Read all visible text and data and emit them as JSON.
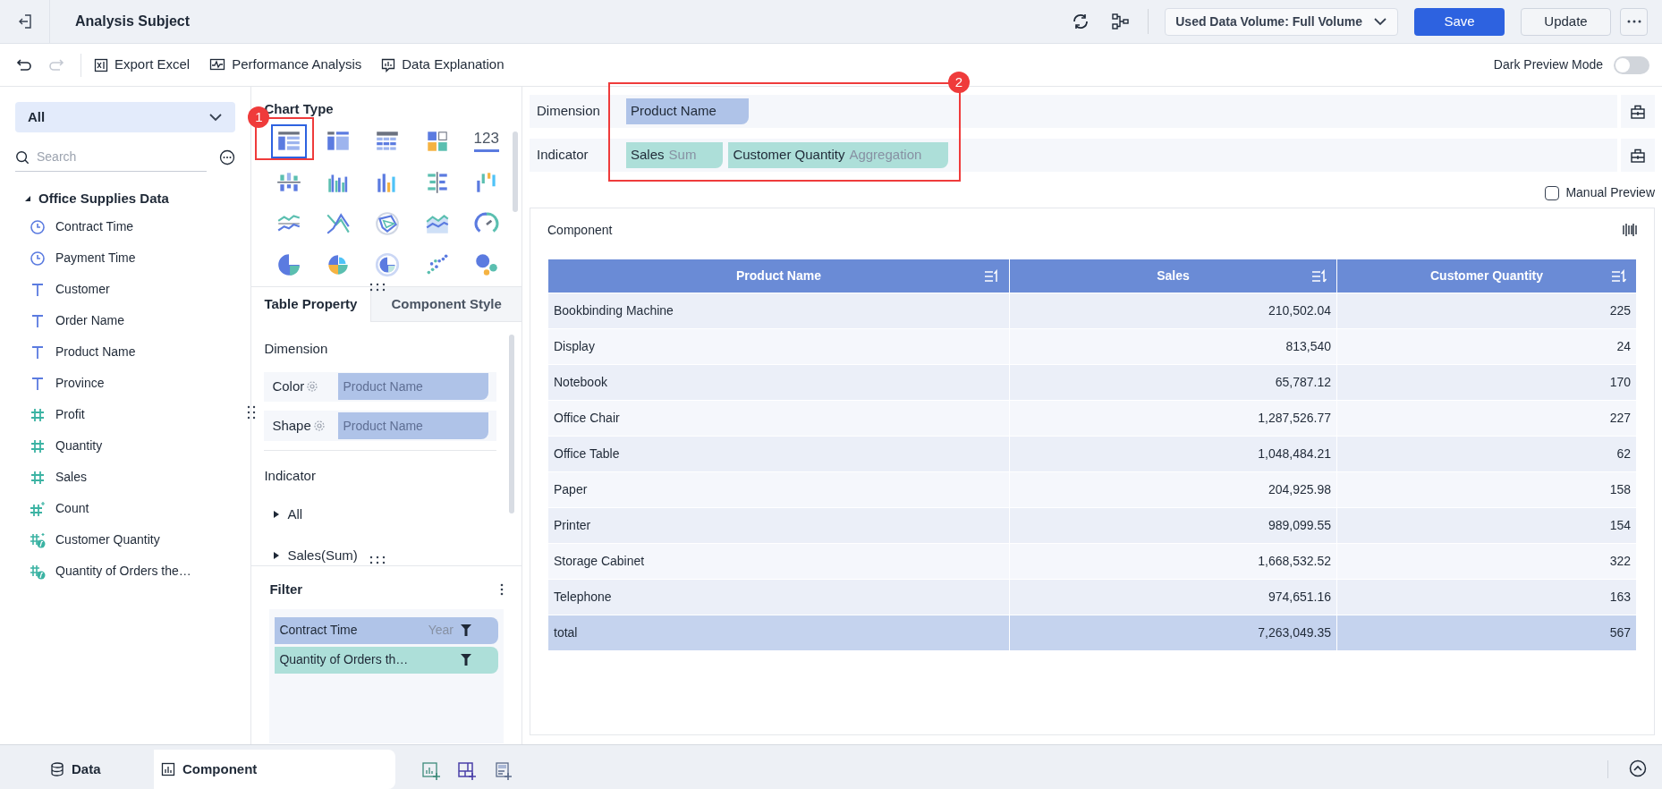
{
  "header": {
    "title": "Analysis Subject",
    "data_volume": "Used Data Volume: Full Volume",
    "buttons": [
      {
        "label": "Save",
        "kind": "primary"
      },
      {
        "label": "Update",
        "kind": "secondary"
      }
    ]
  },
  "toolbar": {
    "actions": [
      {
        "label": "Export Excel",
        "kind": "excel"
      },
      {
        "label": "Performance Analysis",
        "kind": "performance"
      },
      {
        "label": "Data Explanation",
        "kind": "explanation"
      }
    ],
    "dark_preview": {
      "label": "Dark Preview Mode",
      "on": false
    }
  },
  "data_panel": {
    "filter": "All",
    "search_placeholder": "Search",
    "tree": {
      "label": "Office Supplies Data",
      "expanded": true,
      "children": [
        {
          "label": "Contract Time",
          "kind": "time"
        },
        {
          "label": "Payment Time",
          "kind": "time"
        },
        {
          "label": "Customer",
          "kind": "text"
        },
        {
          "label": "Order Name",
          "kind": "text"
        },
        {
          "label": "Product Name",
          "kind": "text"
        },
        {
          "label": "Province",
          "kind": "text"
        },
        {
          "label": "Profit",
          "kind": "number"
        },
        {
          "label": "Quantity",
          "kind": "number"
        },
        {
          "label": "Sales",
          "kind": "number"
        },
        {
          "label": "Count",
          "kind": "count"
        },
        {
          "label": "Customer Quantity",
          "kind": "calc-count"
        },
        {
          "label": "Quantity of Orders the…",
          "kind": "calc"
        }
      ]
    }
  },
  "chart_type": {
    "title": "Chart Type",
    "types": [
      {
        "kind": "table",
        "selected": true
      },
      {
        "kind": "cross-table",
        "selected": false
      },
      {
        "kind": "detail-table",
        "selected": false
      },
      {
        "kind": "kpi",
        "selected": false
      },
      {
        "kind": "number",
        "text": "123",
        "selected": false
      },
      {
        "kind": "stacked-column",
        "selected": false
      },
      {
        "kind": "grouped-column",
        "selected": false
      },
      {
        "kind": "column",
        "selected": false
      },
      {
        "kind": "bar",
        "selected": false
      },
      {
        "kind": "waterfall",
        "selected": false
      },
      {
        "kind": "line",
        "selected": false
      },
      {
        "kind": "crossing-line",
        "selected": false
      },
      {
        "kind": "radar",
        "selected": false
      },
      {
        "kind": "area",
        "selected": false
      },
      {
        "kind": "gauge",
        "selected": false
      },
      {
        "kind": "pie",
        "selected": false
      },
      {
        "kind": "rose",
        "selected": false
      },
      {
        "kind": "ring",
        "selected": false
      },
      {
        "kind": "scatter",
        "selected": false
      },
      {
        "kind": "bubble",
        "selected": false
      }
    ]
  },
  "property_tabs": [
    {
      "label": "Table Property",
      "selected": true
    },
    {
      "label": "Component Style",
      "selected": false
    }
  ],
  "properties": {
    "dimension_title": "Dimension",
    "rows": [
      {
        "label": "Color",
        "placeholder": "Product Name"
      },
      {
        "label": "Shape",
        "placeholder": "Product Name"
      }
    ],
    "indicator_title": "Indicator",
    "items": [
      {
        "label": "All",
        "expanded": false
      },
      {
        "label": "Sales(Sum)",
        "expanded": false
      }
    ]
  },
  "filter": {
    "title": "Filter",
    "items": [
      {
        "label": "Contract Time",
        "detail": "Year",
        "color": "#b0c4e8"
      },
      {
        "label": "Quantity of Orders th…",
        "color": "#addfd9"
      }
    ]
  },
  "fields": [
    {
      "label": "Dimension",
      "kind": "dimension",
      "chips": [
        {
          "name": "Product Name"
        }
      ]
    },
    {
      "label": "Indicator",
      "kind": "indicator",
      "chips": [
        {
          "name": "Sales",
          "agg": "Sum"
        },
        {
          "name": "Customer Quantity",
          "agg": "Aggregation"
        }
      ]
    }
  ],
  "manual_preview": {
    "label": "Manual Preview",
    "checked": false
  },
  "component": {
    "title": "Component",
    "table": {
      "columns": [
        "Product Name",
        "Sales",
        "Customer Quantity"
      ],
      "rows": [
        [
          "Bookbinding Machine",
          "210,502.04",
          "225"
        ],
        [
          "Display",
          "813,540",
          "24"
        ],
        [
          "Notebook",
          "65,787.12",
          "170"
        ],
        [
          "Office Chair",
          "1,287,526.77",
          "227"
        ],
        [
          "Office Table",
          "1,048,484.21",
          "62"
        ],
        [
          "Paper",
          "204,925.98",
          "158"
        ],
        [
          "Printer",
          "989,099.55",
          "154"
        ],
        [
          "Storage Cabinet",
          "1,668,532.52",
          "322"
        ],
        [
          "Telephone",
          "974,651.16",
          "163"
        ]
      ],
      "total": [
        "total",
        "7,263,049.35",
        "567"
      ]
    }
  },
  "bottom_tabs": [
    {
      "label": "Data",
      "kind": "data",
      "selected": false
    },
    {
      "label": "Component",
      "kind": "component",
      "selected": true
    }
  ],
  "annotations": [
    {
      "label": "1"
    },
    {
      "label": "2"
    }
  ]
}
